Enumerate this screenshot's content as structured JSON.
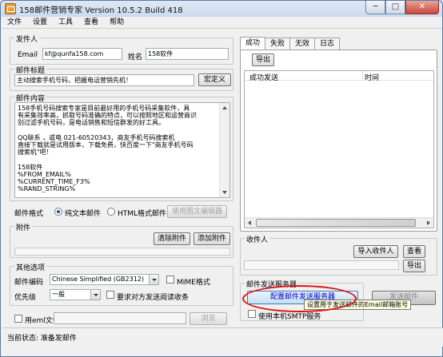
{
  "window": {
    "title": "158邮件营销专家 Version 10.5.2 Build 418",
    "controls": {
      "minimize": "─",
      "maximize": "□",
      "close": "✕"
    }
  },
  "menu": [
    "文件",
    "设置",
    "工具",
    "查看",
    "帮助"
  ],
  "sender": {
    "legend": "发件人",
    "email_label": "Email",
    "email_value": "kf@qunfa158.com",
    "name_label": "姓名",
    "name_value": "158软件"
  },
  "subject": {
    "legend": "邮件标题",
    "value": "主动搜索手机号码，把握电话营销先机！",
    "macro_button": "宏定义"
  },
  "content": {
    "legend": "邮件内容",
    "lines": [
      "158手机号码搜索专家是目前最好用的手机号码采集软件，具",
      "有采集效率高，抓取号码准确的特点，可以按照地区和运营商识",
      "别过滤手机号码，是电话销售和短信群发的好工具。",
      "",
      "QQ联系               ，或电 021-60520343，商友手机号码搜索机",
      "直接下载就是试用版本，下载免费，快百度一下\"商友手机号码",
      "搜索机\"吧！",
      "",
      "158软件",
      "%FROM_EMAIL%",
      "%CURRENT_TIME_F3%",
      "%RAND_STRING%"
    ]
  },
  "format": {
    "label": "邮件格式",
    "plain": "纯文本邮件",
    "html": "HTML格式邮件",
    "editor_button": "使用图文编辑器"
  },
  "attachments": {
    "legend": "附件",
    "clear_button": "清除附件",
    "add_button": "添加附件"
  },
  "other": {
    "legend": "其他选项",
    "encoding_label": "邮件编码",
    "encoding_value": "Chinese Simplified (GB2312)",
    "mime_label": "MIME格式",
    "priority_label": "优先级",
    "priority_value": "一般",
    "receipt_label": "要求对方发送阅读收条"
  },
  "eml": {
    "label": "用eml文件",
    "browse_button": "浏览"
  },
  "status": {
    "label": "当前状态: 准备发邮件"
  },
  "results": {
    "tabs": [
      "成功",
      "失败",
      "无效",
      "日志"
    ],
    "export_button": "导出",
    "col_success": "成功发送",
    "col_time": "时间"
  },
  "recipients": {
    "legend": "收件人",
    "import_button": "导入收件人",
    "view_button": "查看",
    "export_button": "导出"
  },
  "server": {
    "legend": "邮件发送服务器",
    "config_button": "配置邮件发送服务器",
    "local_smtp_label": "使用本机SMTP服务",
    "tooltip": "设置用于发送邮件的Email邮箱账号",
    "send_button_partial": "发送邮件"
  },
  "colors": {
    "highlight_ellipse": "#dd1111",
    "title_gradient_top": "#dfe9f5"
  }
}
